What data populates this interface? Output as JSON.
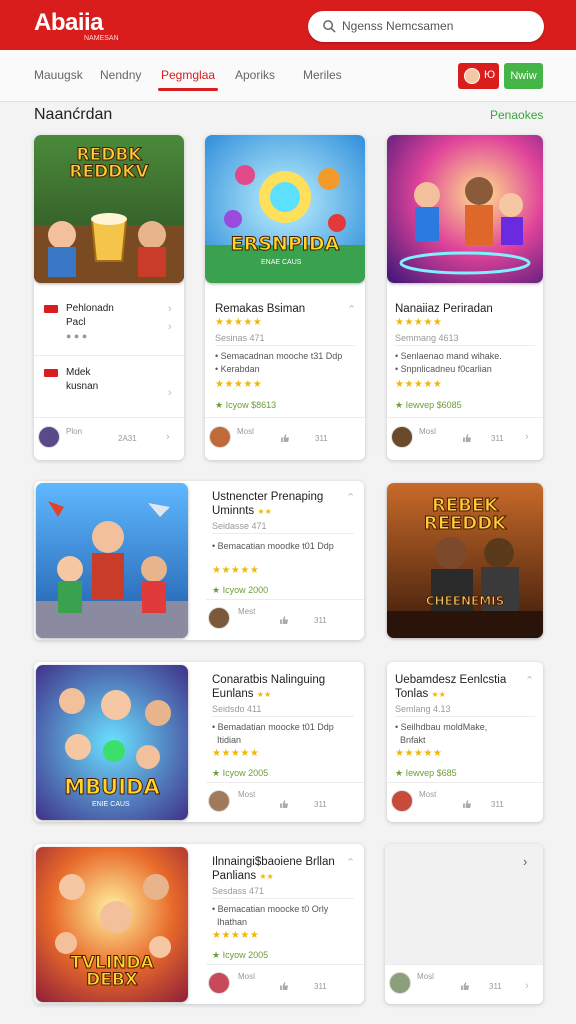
{
  "header": {
    "logo": "Abaiia",
    "logo_sub": "NAMESAN",
    "search_placeholder": "Ngenss Nemcsamen"
  },
  "nav": {
    "tabs": [
      "Mauugsk",
      "Nendny",
      "Pegmglaa",
      "Aporiks",
      "Meriles"
    ],
    "active_tab": "Pegmglaa",
    "btn_red": "Ю",
    "btn_green": "Nwiw"
  },
  "section": {
    "title": "Naanćrdan",
    "link": "Penaokes"
  },
  "cards": {
    "c1": {
      "art": "REDBK REDDKV",
      "item1_title": "Pehlonadn",
      "item1_sub": "Pacl",
      "item2_title": "Mdek",
      "item2_sub": "kusnan",
      "foot_name": "Plon",
      "foot_count": "2A31"
    },
    "c2": {
      "art": "ERSNPIDA",
      "art_sub": "ENAE CAUS",
      "title": "Remakas Bsiman",
      "sub": "Sesinas 471",
      "feat1": "Semacadnan mooche t31 Ddp",
      "feat2": "Kerabdan",
      "link": "Icyow $8613",
      "foot_name": "Mosl",
      "foot_count": "311"
    },
    "c3": {
      "title": "Nanaiiaz Periradan",
      "sub": "Semmang 4613",
      "feat1": "Senlaenao mand wihake.",
      "feat2": "Snpnlicadneu f0carlian",
      "link": "Iewvep $6085",
      "foot_name": "Mosl",
      "foot_count": "311"
    },
    "c4": {
      "title": "Ustnencter Prenaping",
      "title2": "Uminnts",
      "sub": "Seidasse 471",
      "feat1": "Bemacatian moodke t01 Ddp",
      "link": "Icyow 2000",
      "foot_name": "Mest",
      "foot_count": "311"
    },
    "c5": {
      "art": "REBEK REEDDK",
      "art_bottom": "CHEENEMIS"
    },
    "c6": {
      "art": "MBUIDA",
      "art_sub": "ENIE CAUS",
      "title": "Conaratbis Nalinguing",
      "title2": "Eunlans",
      "sub": "Seidsdo 411",
      "feat1": "Bemadatian moocke t01 Ddp",
      "feat2": "Itidian",
      "link": "Icyow 2005",
      "foot_name": "Most",
      "foot_count": "311"
    },
    "c7": {
      "title": "Uebamdesz Eenlcstia",
      "title2": "Tonlas",
      "sub": "Semlang 4.13",
      "feat1": "Seilhdbau moldMake,",
      "feat2": "Bnfakt",
      "link": "Iewvep $685",
      "foot_name": "Most",
      "foot_count": "311"
    },
    "c8": {
      "art": "TVLINDA DEBX",
      "title": "Ilnnaingi$baoiene Brllan",
      "title2": "Panlians",
      "sub": "Sesdass 471",
      "feat1": "Bemacatian moocke t0 Orly",
      "feat2": "Ihathan",
      "link": "Icyow 2005",
      "foot_name": "Mosl",
      "foot_count": "311"
    },
    "c9": {
      "foot_name": "Mosl",
      "foot_count": "311"
    },
    "stars5": "★★★★★",
    "stars2": "★★",
    "chevron": "›",
    "chevron_up": "⌃"
  }
}
